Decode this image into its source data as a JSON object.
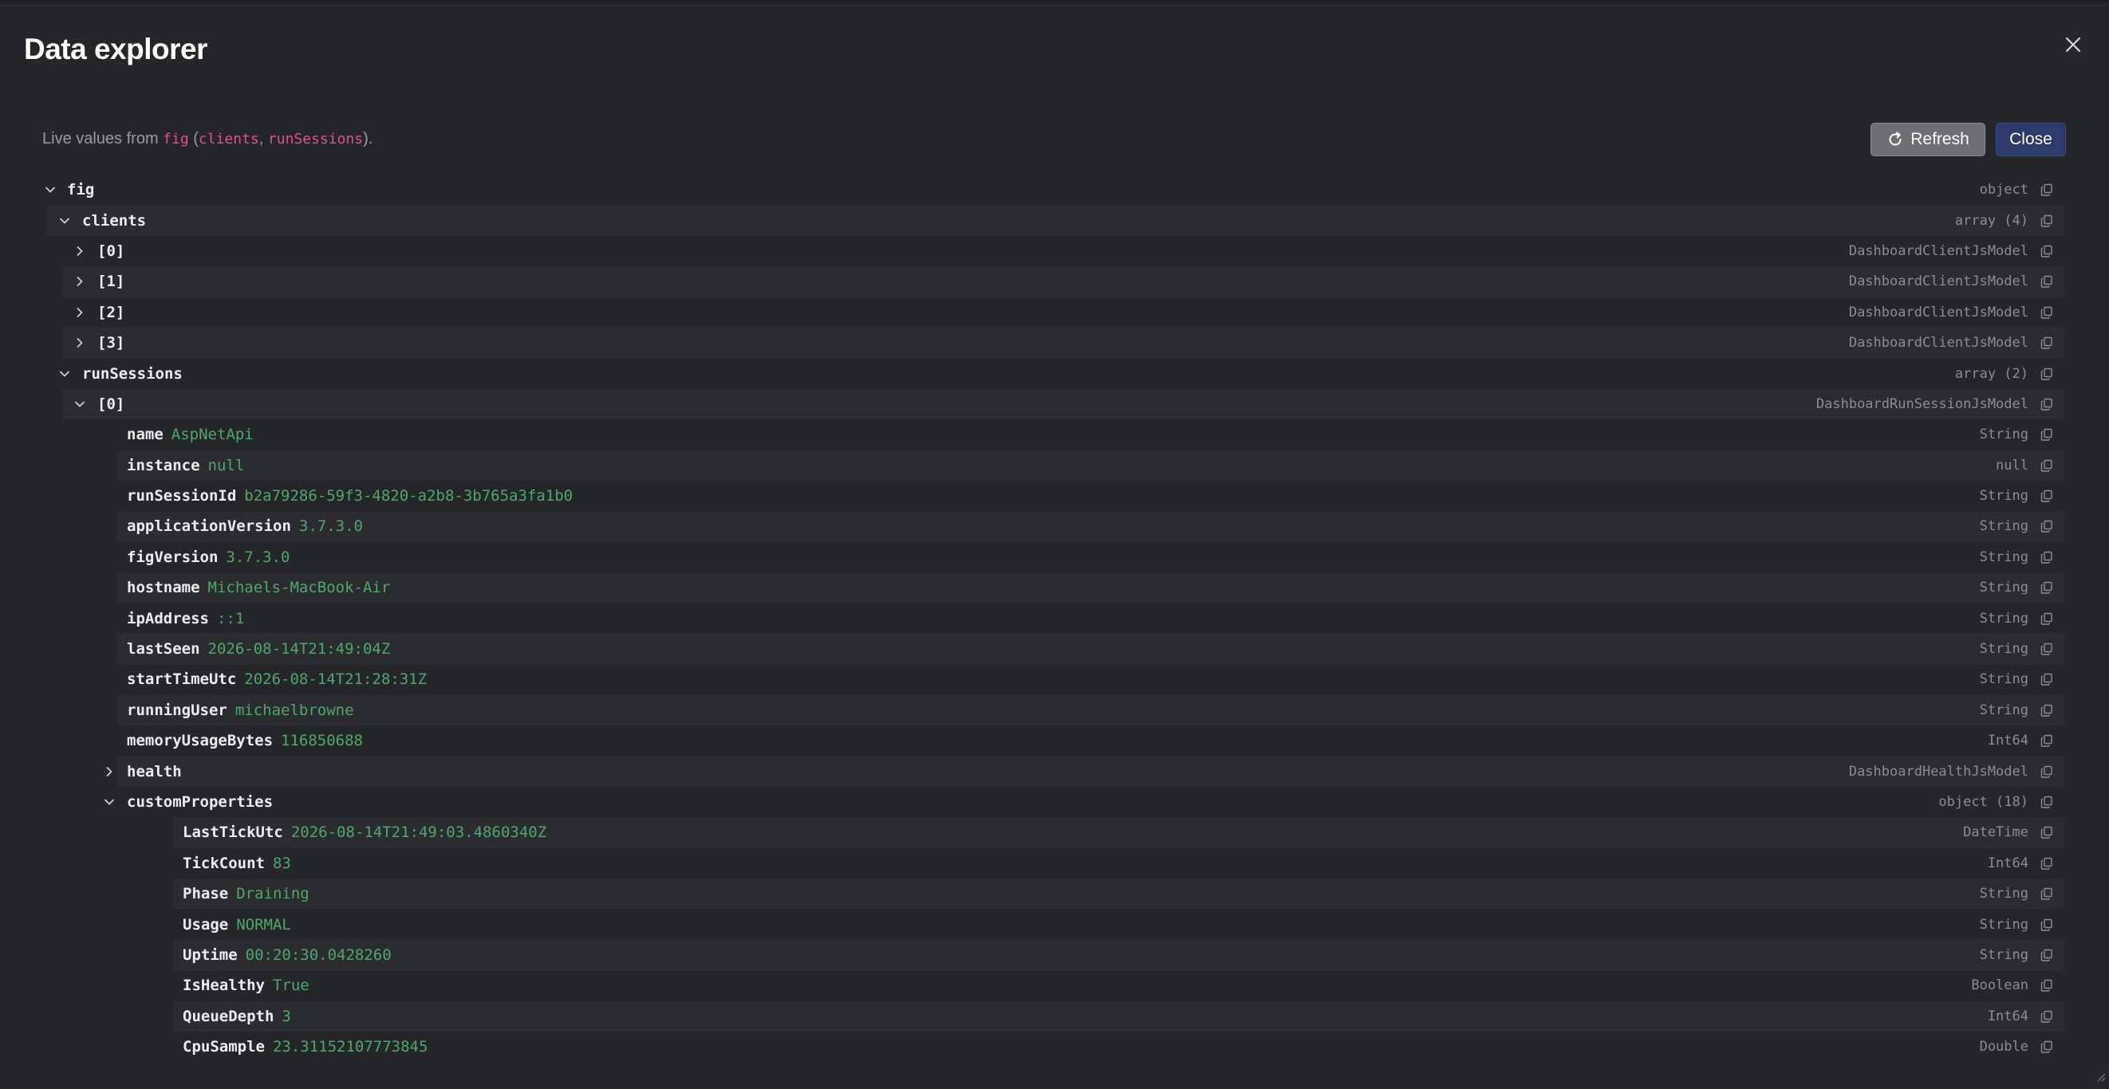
{
  "dialog": {
    "title": "Data explorer",
    "subtitle_prefix": "Live values from ",
    "subtitle_obj": "fig",
    "subtitle_open": " (",
    "subtitle_k1": "clients",
    "subtitle_sep": ", ",
    "subtitle_k2": "runSessions",
    "subtitle_close": ").",
    "refresh_label": "Refresh",
    "close_label": "Close"
  },
  "tree": [
    {
      "depth": 0,
      "chev": "down",
      "key": "fig",
      "value": "",
      "type": "object"
    },
    {
      "depth": 1,
      "chev": "down",
      "key": "clients",
      "value": "",
      "type": "array (4)"
    },
    {
      "depth": 2,
      "chev": "right",
      "key": "[0]",
      "value": "",
      "type": "DashboardClientJsModel"
    },
    {
      "depth": 2,
      "chev": "right",
      "key": "[1]",
      "value": "",
      "type": "DashboardClientJsModel"
    },
    {
      "depth": 2,
      "chev": "right",
      "key": "[2]",
      "value": "",
      "type": "DashboardClientJsModel"
    },
    {
      "depth": 2,
      "chev": "right",
      "key": "[3]",
      "value": "",
      "type": "DashboardClientJsModel"
    },
    {
      "depth": 1,
      "chev": "down",
      "key": "runSessions",
      "value": "",
      "type": "array (2)"
    },
    {
      "depth": 2,
      "chev": "down",
      "key": "[0]",
      "value": "",
      "type": "DashboardRunSessionJsModel"
    },
    {
      "depth": 3,
      "chev": "",
      "key": "name",
      "value": "AspNetApi",
      "type": "String"
    },
    {
      "depth": 3,
      "chev": "",
      "key": "instance",
      "value": "null",
      "type": "null"
    },
    {
      "depth": 3,
      "chev": "",
      "key": "runSessionId",
      "value": "b2a79286-59f3-4820-a2b8-3b765a3fa1b0",
      "type": "String"
    },
    {
      "depth": 3,
      "chev": "",
      "key": "applicationVersion",
      "value": "3.7.3.0",
      "type": "String"
    },
    {
      "depth": 3,
      "chev": "",
      "key": "figVersion",
      "value": "3.7.3.0",
      "type": "String"
    },
    {
      "depth": 3,
      "chev": "",
      "key": "hostname",
      "value": "Michaels-MacBook-Air",
      "type": "String"
    },
    {
      "depth": 3,
      "chev": "",
      "key": "ipAddress",
      "value": "::1",
      "type": "String"
    },
    {
      "depth": 3,
      "chev": "",
      "key": "lastSeen",
      "value": "2026-08-14T21:49:04Z",
      "type": "String"
    },
    {
      "depth": 3,
      "chev": "",
      "key": "startTimeUtc",
      "value": "2026-08-14T21:28:31Z",
      "type": "String"
    },
    {
      "depth": 3,
      "chev": "",
      "key": "runningUser",
      "value": "michaelbrowne",
      "type": "String"
    },
    {
      "depth": 3,
      "chev": "",
      "key": "memoryUsageBytes",
      "value": "116850688",
      "type": "Int64"
    },
    {
      "depth": 3,
      "chev": "right",
      "key": "health",
      "value": "",
      "type": "DashboardHealthJsModel"
    },
    {
      "depth": 3,
      "chev": "down",
      "key": "customProperties",
      "value": "",
      "type": "object (18)"
    },
    {
      "depth": 4,
      "chev": "",
      "key": "LastTickUtc",
      "value": "2026-08-14T21:49:03.4860340Z",
      "type": "DateTime"
    },
    {
      "depth": 4,
      "chev": "",
      "key": "TickCount",
      "value": "83",
      "type": "Int64"
    },
    {
      "depth": 4,
      "chev": "",
      "key": "Phase",
      "value": "Draining",
      "type": "String"
    },
    {
      "depth": 4,
      "chev": "",
      "key": "Usage",
      "value": "NORMAL",
      "type": "String"
    },
    {
      "depth": 4,
      "chev": "",
      "key": "Uptime",
      "value": "00:20:30.0428260",
      "type": "String"
    },
    {
      "depth": 4,
      "chev": "",
      "key": "IsHealthy",
      "value": "True",
      "type": "Boolean"
    },
    {
      "depth": 4,
      "chev": "",
      "key": "QueueDepth",
      "value": "3",
      "type": "Int64"
    },
    {
      "depth": 4,
      "chev": "",
      "key": "CpuSample",
      "value": "23.31152107773845",
      "type": "Double"
    }
  ]
}
